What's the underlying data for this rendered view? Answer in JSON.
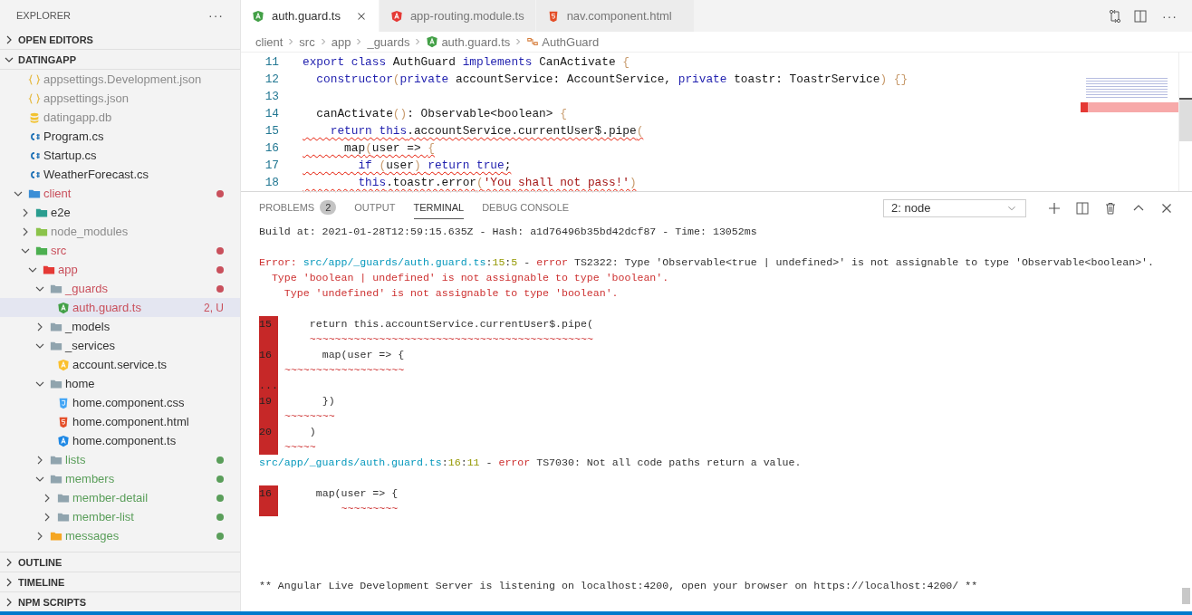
{
  "sidebar": {
    "title": "EXPLORER",
    "more": "···",
    "sections_top": [
      {
        "label": "OPEN EDITORS",
        "expanded": false
      },
      {
        "label": "DATINGAPP",
        "expanded": true
      }
    ],
    "tree": [
      {
        "name": "appsettings.Development.json",
        "kind": "json",
        "dimmed": true,
        "selected": false
      },
      {
        "name": "appsettings.json",
        "kind": "json",
        "dimmed": true,
        "selected": false
      },
      {
        "name": "datingapp.db",
        "kind": "db",
        "dimmed": true,
        "selected": false
      },
      {
        "name": "Program.cs",
        "kind": "csharp",
        "selected": false
      },
      {
        "name": "Startup.cs",
        "kind": "csharp",
        "selected": false
      },
      {
        "name": "WeatherForecast.cs",
        "kind": "csharp",
        "selected": false
      },
      {
        "name": "client",
        "kind": "folder-client",
        "expanded": true,
        "color": "#c9505c",
        "dot": true,
        "selected": false,
        "children": [
          {
            "name": "e2e",
            "kind": "folder-e2e",
            "expanded": false,
            "selected": false
          },
          {
            "name": "node_modules",
            "kind": "folder-node",
            "expanded": false,
            "dimmed": true,
            "selected": false
          },
          {
            "name": "src",
            "kind": "folder-src",
            "expanded": true,
            "color": "#c9505c",
            "dot": true,
            "selected": false,
            "children": [
              {
                "name": "app",
                "kind": "folder-app",
                "expanded": true,
                "color": "#c9505c",
                "dot": true,
                "selected": false,
                "children": [
                  {
                    "name": "_guards",
                    "kind": "folder",
                    "expanded": true,
                    "color": "#c9505c",
                    "dot": true,
                    "selected": false,
                    "children": [
                      {
                        "name": "auth.guard.ts",
                        "kind": "ng-guard",
                        "color": "#c9505c",
                        "badge": "2, U",
                        "selected": true
                      }
                    ]
                  },
                  {
                    "name": "_models",
                    "kind": "folder",
                    "expanded": false,
                    "selected": false
                  },
                  {
                    "name": "_services",
                    "kind": "folder",
                    "expanded": true,
                    "selected": false,
                    "children": [
                      {
                        "name": "account.service.ts",
                        "kind": "ng-service",
                        "selected": false
                      }
                    ]
                  },
                  {
                    "name": "home",
                    "kind": "folder",
                    "expanded": true,
                    "selected": false,
                    "children": [
                      {
                        "name": "home.component.css",
                        "kind": "css",
                        "selected": false
                      },
                      {
                        "name": "home.component.html",
                        "kind": "html",
                        "selected": false
                      },
                      {
                        "name": "home.component.ts",
                        "kind": "ng-component",
                        "selected": false
                      }
                    ]
                  },
                  {
                    "name": "lists",
                    "kind": "folder",
                    "expanded": false,
                    "color": "#5a9e5a",
                    "dot": true,
                    "selected": false
                  },
                  {
                    "name": "members",
                    "kind": "folder",
                    "expanded": true,
                    "color": "#5a9e5a",
                    "dot": true,
                    "selected": false,
                    "children": [
                      {
                        "name": "member-detail",
                        "kind": "folder",
                        "expanded": false,
                        "color": "#5a9e5a",
                        "dot": true,
                        "selected": false
                      },
                      {
                        "name": "member-list",
                        "kind": "folder",
                        "expanded": false,
                        "color": "#5a9e5a",
                        "dot": true,
                        "selected": false
                      }
                    ]
                  },
                  {
                    "name": "messages",
                    "kind": "folder-messages",
                    "expanded": false,
                    "color": "#5a9e5a",
                    "dot": true,
                    "selected": false
                  }
                ]
              }
            ]
          }
        ]
      }
    ],
    "sections_bottom": [
      {
        "label": "OUTLINE",
        "expanded": false
      },
      {
        "label": "TIMELINE",
        "expanded": false
      },
      {
        "label": "NPM SCRIPTS",
        "expanded": false
      }
    ]
  },
  "tabs": [
    {
      "label": "auth.guard.ts",
      "kind": "ng-guard",
      "selected": true
    },
    {
      "label": "app-routing.module.ts",
      "kind": "ng-routing",
      "selected": false
    },
    {
      "label": "nav.component.html",
      "kind": "html",
      "selected": false
    }
  ],
  "editor_actions": {
    "more": "···"
  },
  "breadcrumbs": [
    {
      "label": "client"
    },
    {
      "label": "src"
    },
    {
      "label": "app"
    },
    {
      "label": "_guards"
    },
    {
      "label": "auth.guard.ts",
      "kind": "ng-guard"
    },
    {
      "label": "AuthGuard",
      "kind": "class"
    }
  ],
  "code": [
    {
      "number": "11",
      "tokens": [
        {
          "text": "export class ",
          "kind": "keyword"
        },
        {
          "text": "AuthGuard ",
          "kind": "plain"
        },
        {
          "text": "implements ",
          "kind": "keyword"
        },
        {
          "text": "CanActivate ",
          "kind": "plain"
        },
        {
          "text": "{",
          "kind": "bracket"
        }
      ]
    },
    {
      "number": "12",
      "tokens": [
        {
          "text": "  constructor",
          "kind": "keyword"
        },
        {
          "text": "(",
          "kind": "bracket"
        },
        {
          "text": "private ",
          "kind": "keyword"
        },
        {
          "text": "accountService: AccountService, ",
          "kind": "plain"
        },
        {
          "text": "private ",
          "kind": "keyword"
        },
        {
          "text": "toastr: ToastrService",
          "kind": "plain"
        },
        {
          "text": ") {}",
          "kind": "bracket"
        }
      ]
    },
    {
      "number": "13"
    },
    {
      "number": "14",
      "tokens": [
        {
          "text": "  canActivate",
          "kind": "plain"
        },
        {
          "text": "()",
          "kind": "bracket"
        },
        {
          "text": ": Observable<boolean> ",
          "kind": "plain"
        },
        {
          "text": "{",
          "kind": "bracket"
        }
      ]
    },
    {
      "number": "15",
      "squiggle": true,
      "tokens": [
        {
          "text": "    return this",
          "kind": "keyword"
        },
        {
          "text": ".accountService.currentUser$.pipe",
          "kind": "plain"
        },
        {
          "text": "(",
          "kind": "bracket"
        }
      ]
    },
    {
      "number": "16",
      "squiggle": true,
      "tokens": [
        {
          "text": "      map",
          "kind": "plain"
        },
        {
          "text": "(",
          "kind": "bracket"
        },
        {
          "text": "user => ",
          "kind": "plain"
        },
        {
          "text": "{",
          "kind": "bracket"
        }
      ]
    },
    {
      "number": "17",
      "squiggle": true,
      "tokens": [
        {
          "text": "        if ",
          "kind": "keyword"
        },
        {
          "text": "(",
          "kind": "bracket"
        },
        {
          "text": "user",
          "kind": "plain"
        },
        {
          "text": ") ",
          "kind": "bracket"
        },
        {
          "text": "return true",
          "kind": "keyword"
        },
        {
          "text": ";",
          "kind": "plain"
        }
      ]
    },
    {
      "number": "18",
      "squiggle": true,
      "tokens": [
        {
          "text": "        this",
          "kind": "keyword"
        },
        {
          "text": ".toastr.error",
          "kind": "plain"
        },
        {
          "text": "(",
          "kind": "bracket"
        },
        {
          "text": "'You shall not pass!'",
          "kind": "string"
        },
        {
          "text": ")",
          "kind": "bracket"
        }
      ]
    }
  ],
  "panel": {
    "tabs": [
      {
        "label": "PROBLEMS",
        "badge": "2",
        "selected": false
      },
      {
        "label": "OUTPUT",
        "selected": false
      },
      {
        "label": "TERMINAL",
        "selected": true
      },
      {
        "label": "DEBUG CONSOLE",
        "selected": false
      }
    ],
    "terminal_select": "2: node",
    "lines": [
      {
        "kind": "text",
        "segments": [
          {
            "text": "Build at: 2021-01-28T12:59:15.635Z - Hash: a1d76496b35bd42dcf87 - Time: 13052ms",
            "kind": "plain"
          }
        ]
      },
      {
        "kind": "blank"
      },
      {
        "kind": "text",
        "segments": [
          {
            "text": "Error: ",
            "kind": "error"
          },
          {
            "text": "src/app/_guards/auth.guard.ts",
            "kind": "path"
          },
          {
            "text": ":",
            "kind": "plain"
          },
          {
            "text": "15",
            "kind": "number"
          },
          {
            "text": ":",
            "kind": "plain"
          },
          {
            "text": "5",
            "kind": "number"
          },
          {
            "text": " - ",
            "kind": "plain"
          },
          {
            "text": "error",
            "kind": "error"
          },
          {
            "text": " TS2322: Type 'Observable<true | undefined>' is not assignable to type 'Observable<boolean>'.",
            "kind": "plain"
          }
        ]
      },
      {
        "kind": "text",
        "segments": [
          {
            "text": "  Type 'boolean | undefined' is not assignable to type 'boolean'.",
            "kind": "error"
          }
        ]
      },
      {
        "kind": "text",
        "segments": [
          {
            "text": "    Type 'undefined' is not assignable to type 'boolean'.",
            "kind": "error"
          }
        ]
      },
      {
        "kind": "blank"
      },
      {
        "kind": "snippet",
        "number": "15",
        "segments": [
          {
            "text": "     return this.accountService.currentUser$.pipe(",
            "kind": "plain"
          }
        ]
      },
      {
        "kind": "snippet",
        "segments": [
          {
            "text": "     ~~~~~~~~~~~~~~~~~~~~~~~~~~~~~~~~~~~~~~~~~~~~~",
            "kind": "error"
          }
        ]
      },
      {
        "kind": "snippet",
        "number": "16",
        "segments": [
          {
            "text": "       map(user => {",
            "kind": "plain"
          }
        ]
      },
      {
        "kind": "snippet",
        "segments": [
          {
            "text": " ~~~~~~~~~~~~~~~~~~~",
            "kind": "error"
          }
        ]
      },
      {
        "kind": "snippet",
        "number": "..."
      },
      {
        "kind": "snippet",
        "number": "19",
        "segments": [
          {
            "text": "       })",
            "kind": "plain"
          }
        ]
      },
      {
        "kind": "snippet",
        "segments": [
          {
            "text": " ~~~~~~~~",
            "kind": "error"
          }
        ]
      },
      {
        "kind": "snippet",
        "number": "20",
        "segments": [
          {
            "text": "     )",
            "kind": "plain"
          }
        ]
      },
      {
        "kind": "snippet",
        "segments": [
          {
            "text": " ~~~~~",
            "kind": "error"
          }
        ]
      },
      {
        "kind": "text",
        "segments": [
          {
            "text": "src/app/_guards/auth.guard.ts",
            "kind": "path"
          },
          {
            "text": ":",
            "kind": "plain"
          },
          {
            "text": "16",
            "kind": "number"
          },
          {
            "text": ":",
            "kind": "plain"
          },
          {
            "text": "11",
            "kind": "number"
          },
          {
            "text": " - ",
            "kind": "plain"
          },
          {
            "text": "error",
            "kind": "error"
          },
          {
            "text": " TS7030: Not all code paths return a value.",
            "kind": "plain"
          }
        ]
      },
      {
        "kind": "blank"
      },
      {
        "kind": "snippet",
        "number": "16",
        "segments": [
          {
            "text": "      map(user => {",
            "kind": "plain"
          }
        ]
      },
      {
        "kind": "snippet",
        "segments": [
          {
            "text": "          ~~~~~~~~~",
            "kind": "error"
          }
        ]
      },
      {
        "kind": "blank"
      },
      {
        "kind": "blank"
      },
      {
        "kind": "blank"
      },
      {
        "kind": "blank"
      },
      {
        "kind": "text",
        "segments": [
          {
            "text": "** Angular Live Development Server is listening on localhost:4200, open your browser on https://localhost:4200/ **",
            "kind": "plain"
          }
        ]
      }
    ]
  }
}
